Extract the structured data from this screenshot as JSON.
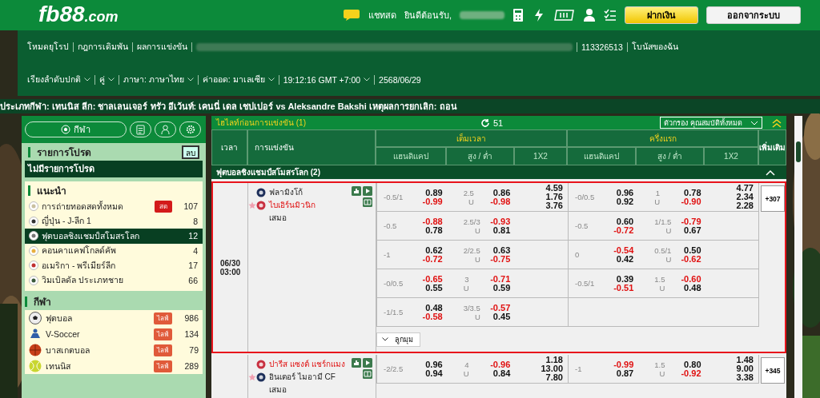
{
  "header": {
    "logo": "fb88",
    "logo_suffix": ".com",
    "chat": "แชทสด",
    "welcome": "ยินดีต้อนรับ,",
    "deposit": "ฝากเงิน",
    "logout": "ออกจากระบบ"
  },
  "top_links": [
    "โหมดยุโรป",
    "กฎการเดิมพัน",
    "ผลการแข่งขัน"
  ],
  "account_links": [
    "113326513",
    "โบนัสของฉัน"
  ],
  "settings": [
    {
      "label": "เรียงลำดับปกติ",
      "dropdown": true
    },
    {
      "label": "คู่",
      "dropdown": true
    },
    {
      "label": "ภาษา: ภาษาไทย",
      "dropdown": true
    },
    {
      "label": "ค่าออด: มาเลเซีย",
      "dropdown": true
    },
    {
      "label": "19:12:16 GMT +7:00",
      "dropdown": true
    },
    {
      "label": "2568/06/29",
      "dropdown": false
    }
  ],
  "ticker": "ประเภทกีฬา: เทนนิส ลีก: ชาลเลนเจอร์ ทรัว อีเว้นท์: เคนนี่ เดล เชปเปอร์ vs Aleksandre Bakshi เหตุผลการยกเลิก: ถอน",
  "sidebar": {
    "tabs": [
      {
        "kind": "sports",
        "label": "กีฬา"
      },
      {
        "kind": "betslip"
      },
      {
        "kind": "account"
      },
      {
        "kind": "settings"
      }
    ],
    "favorites": {
      "title": "รายการโปรด",
      "clear": "ลบ",
      "empty": "ไม่มีรายการโปรด"
    },
    "recommended": {
      "title": "แนะนำ",
      "items": [
        {
          "label": "การถ่ายทอดสดทั้งหมด",
          "badge": "สด",
          "count": "107",
          "selected": false
        },
        {
          "label": "ญี่ปุ่น - J-ลีก 1",
          "count": "8",
          "selected": false
        },
        {
          "label": "ฟุตบอลชิงแชมป์สโมสรโลก",
          "count": "12",
          "selected": true
        },
        {
          "label": "คอนคาแคฟโกลด์คัพ",
          "count": "4",
          "selected": false
        },
        {
          "label": "อเมริกา - พรีเมียร์ลีก",
          "count": "17",
          "selected": false
        },
        {
          "label": "วิมเบิลดัล ประเภทชาย",
          "count": "66",
          "selected": false
        }
      ]
    },
    "sports": {
      "title": "กีฬา",
      "items": [
        {
          "kind": "football",
          "label": "ฟุตบอล",
          "badge": "ไลฟ์",
          "count": "986"
        },
        {
          "kind": "vsoccer",
          "label": "V-Soccer",
          "badge": "ไลฟ์",
          "count": "134"
        },
        {
          "kind": "basketball",
          "label": "บาสเกตบอล",
          "badge": "ไลฟ์",
          "count": "79"
        },
        {
          "kind": "tennis",
          "label": "เทนนิส",
          "badge": "ไลฟ์",
          "count": "289"
        }
      ]
    }
  },
  "main": {
    "title": "ไฮไลท์ก่อนการแข่งขัน (1)",
    "refresh_count": "51",
    "filter": "ตัวกรอง คุณสมบัติทั้งหมด",
    "columns": {
      "time": "เวลา",
      "match": "การแข่งขัน",
      "more": "เพิ่มเติม",
      "periods": [
        {
          "label": "เต็มเวลา",
          "markets": [
            "แฮนดิแคป",
            "สูง / ต่ำ",
            "1X2"
          ]
        },
        {
          "label": "ครึ่งแรก",
          "markets": [
            "แฮนดิแคป",
            "สูง / ต่ำ",
            "1X2"
          ]
        }
      ]
    },
    "league": {
      "name": "ฟุตบอลชิงแชมป์สโมสรโลก (2)",
      "expanded": true
    },
    "matches": [
      {
        "date": "06/30",
        "time": "03:00",
        "highlighted": true,
        "teams": [
          {
            "name": "ฟลามิงโก้",
            "favorite": false
          },
          {
            "name": "ไบเอิร์นมิวนิก",
            "favorite": true
          }
        ],
        "draw": "เสมอ",
        "more": "+307",
        "extra": "ลูกมุม",
        "lines": [
          {
            "ft": {
              "hdp": "-0.5/1",
              "hdp_odds": [
                "0.89",
                "-0.99"
              ],
              "ou": "2.5",
              "ou_side": "U",
              "ou_odds": [
                "0.86",
                "-0.98"
              ],
              "x12": [
                "4.59",
                "1.76",
                "3.76"
              ]
            },
            "ht": {
              "hdp": "-0/0.5",
              "hdp_odds": [
                "0.96",
                "0.92"
              ],
              "ou": "1",
              "ou_side": "U",
              "ou_odds": [
                "0.78",
                "-0.90"
              ],
              "x12": [
                "4.77",
                "2.34",
                "2.28"
              ]
            }
          },
          {
            "ft": {
              "hdp": "-0.5",
              "hdp_odds": [
                "-0.88",
                "0.78"
              ],
              "ou": "2.5/3",
              "ou_side": "U",
              "ou_odds": [
                "-0.93",
                "0.81"
              ]
            },
            "ht": {
              "hdp": "-0.5",
              "hdp_odds": [
                "0.60",
                "-0.72"
              ],
              "ou": "1/1.5",
              "ou_side": "U",
              "ou_odds": [
                "-0.79",
                "0.67"
              ]
            }
          },
          {
            "ft": {
              "hdp": "-1",
              "hdp_odds": [
                "0.62",
                "-0.72"
              ],
              "ou": "2/2.5",
              "ou_side": "U",
              "ou_odds": [
                "0.63",
                "-0.75"
              ]
            },
            "ht": {
              "hdp": "0",
              "hdp_odds": [
                "-0.54",
                "0.42"
              ],
              "ou": "0.5/1",
              "ou_side": "U",
              "ou_odds": [
                "0.50",
                "-0.62"
              ]
            }
          },
          {
            "ft": {
              "hdp": "-0/0.5",
              "hdp_odds": [
                "-0.65",
                "0.55"
              ],
              "ou": "3",
              "ou_side": "U",
              "ou_odds": [
                "-0.71",
                "0.59"
              ]
            },
            "ht": {
              "hdp": "-0.5/1",
              "hdp_odds": [
                "0.39",
                "-0.51"
              ],
              "ou": "1.5",
              "ou_side": "U",
              "ou_odds": [
                "-0.60",
                "0.48"
              ]
            }
          },
          {
            "ft": {
              "hdp": "-1/1.5",
              "hdp_odds": [
                "0.48",
                "-0.58"
              ],
              "ou": "3/3.5",
              "ou_side": "U",
              "ou_odds": [
                "-0.57",
                "0.45"
              ]
            }
          }
        ]
      },
      {
        "highlighted": false,
        "teams": [
          {
            "name": "ปารีส แซงต์ แชร์กแมง",
            "favorite": true
          },
          {
            "name": "อินเตอร์ ไมอามี CF",
            "favorite": false
          }
        ],
        "draw": "เสมอ",
        "more": "+345",
        "lines": [
          {
            "ft": {
              "hdp": "-2/2.5",
              "hdp_odds": [
                "0.96",
                "0.94"
              ],
              "ou": "4",
              "ou_side": "U",
              "ou_odds": [
                "-0.96",
                "0.84"
              ],
              "x12": [
                "1.18",
                "13.00",
                "7.80"
              ]
            },
            "ht": {
              "hdp": "-1",
              "hdp_odds": [
                "-0.99",
                "0.87"
              ],
              "ou": "1.5",
              "ou_side": "U",
              "ou_odds": [
                "0.80",
                "-0.92"
              ],
              "x12": [
                "1.48",
                "9.00",
                "3.38"
              ]
            }
          }
        ]
      }
    ]
  }
}
